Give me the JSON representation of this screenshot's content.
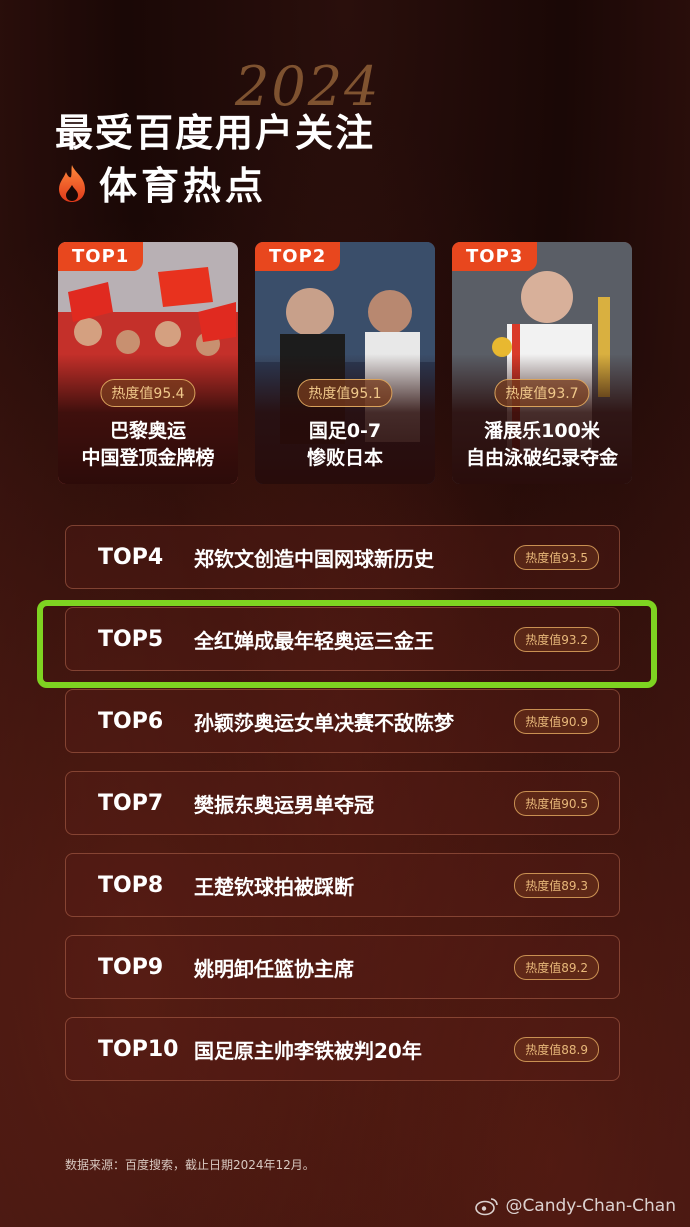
{
  "header": {
    "year_script": "2024",
    "title_line1": "最受百度用户关注",
    "title_line2": "体育热点"
  },
  "top3": [
    {
      "rank": "TOP1",
      "heat": "热度值95.4",
      "title_line1": "巴黎奥运",
      "title_line2": "中国登顶金牌榜"
    },
    {
      "rank": "TOP2",
      "heat": "热度值95.1",
      "title_line1": "国足0-7",
      "title_line2": "惨败日本"
    },
    {
      "rank": "TOP3",
      "heat": "热度值93.7",
      "title_line1": "潘展乐100米",
      "title_line2": "自由泳破纪录夺金"
    }
  ],
  "list": [
    {
      "rank": "TOP4",
      "topic": "郑钦文创造中国网球新历史",
      "heat": "热度值93.5"
    },
    {
      "rank": "TOP5",
      "topic": "全红婵成最年轻奥运三金王",
      "heat": "热度值93.2"
    },
    {
      "rank": "TOP6",
      "topic": "孙颖莎奥运女单决赛不敌陈梦",
      "heat": "热度值90.9"
    },
    {
      "rank": "TOP7",
      "topic": "樊振东奥运男单夺冠",
      "heat": "热度值90.5"
    },
    {
      "rank": "TOP8",
      "topic": "王楚钦球拍被踩断",
      "heat": "热度值89.3"
    },
    {
      "rank": "TOP9",
      "topic": "姚明卸任篮协主席",
      "heat": "热度值89.2"
    },
    {
      "rank": "TOP10",
      "topic": "国足原主帅李铁被判20年",
      "heat": "热度值88.9"
    }
  ],
  "footer": {
    "source": "数据来源：百度搜索，截止日期2024年12月。",
    "watermark": "@Candy-Chan-Chan"
  },
  "colors": {
    "accent": "#e8471e",
    "highlight": "#7ed321",
    "heat_text": "#e8b87a"
  }
}
